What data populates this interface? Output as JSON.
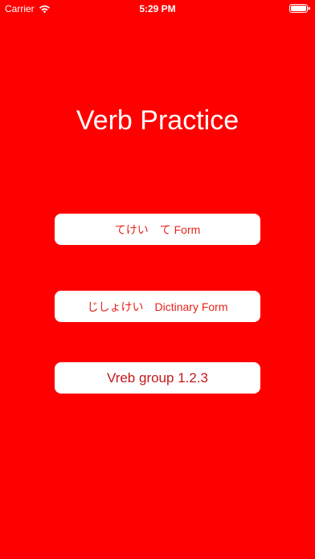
{
  "status_bar": {
    "carrier": "Carrier",
    "time": "5:29 PM"
  },
  "title": "Verb Practice",
  "buttons": {
    "te_form": "てけい　て Form",
    "dictionary_form": "じしょけい　Dictinary Form",
    "verb_group": "Vreb group 1.2.3"
  },
  "colors": {
    "background": "#ff0000",
    "button_background": "#ffffff",
    "button_text": "#e3241b",
    "status_text": "#ffffff"
  },
  "icons": {
    "wifi": "wifi-icon",
    "battery": "battery-icon"
  }
}
